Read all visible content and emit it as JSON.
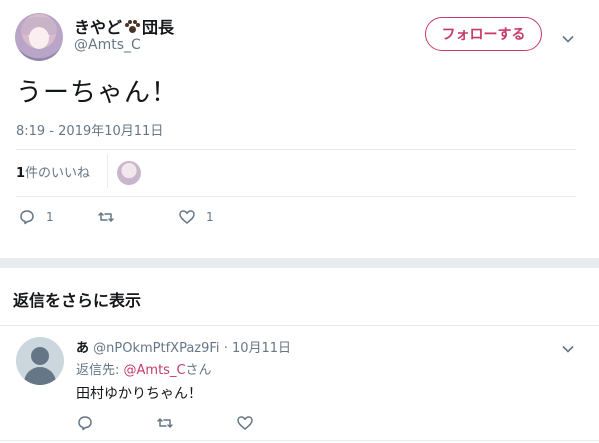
{
  "tweet": {
    "user": {
      "name_prefix": "きやど",
      "name_suffix": "団長",
      "handle": "@Amts_C"
    },
    "follow_label": "フォローする",
    "text": "うーちゃん！",
    "timestamp": "8:19 - 2019年10月11日",
    "likes": {
      "count": "1",
      "label": "件のいいね"
    },
    "actions": {
      "reply_count": "1",
      "like_count": "1"
    }
  },
  "replies_section": {
    "title": "返信をさらに表示"
  },
  "reply": {
    "name": "あ",
    "handle": "@nPOkmPtfXPaz9Fi",
    "separator": "·",
    "date": "10月11日",
    "reply_to_prefix": "返信先: ",
    "reply_to_handle": "@Amts_C",
    "reply_to_suffix": "さん",
    "text": "田村ゆかりちゃん！"
  },
  "colors": {
    "accent": "#c73a68",
    "muted_text": "#657786",
    "divider": "#e6ecf0"
  },
  "icons": [
    "paw-icon",
    "chevron-down-icon",
    "reply-icon",
    "retweet-icon",
    "like-icon",
    "default-avatar-icon"
  ]
}
